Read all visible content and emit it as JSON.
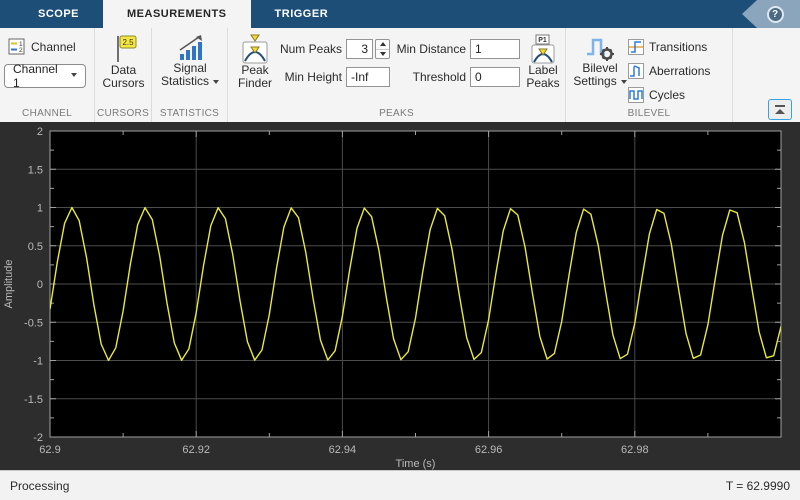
{
  "tabs": {
    "items": [
      {
        "label": "SCOPE",
        "active": false
      },
      {
        "label": "MEASUREMENTS",
        "active": true
      },
      {
        "label": "TRIGGER",
        "active": false
      }
    ],
    "help_label": "?"
  },
  "toolbar": {
    "channel": {
      "label": "Channel",
      "dropdown_value": "Channel 1",
      "group": "CHANNEL"
    },
    "cursors": {
      "line1": "Data",
      "line2": "Cursors",
      "badge": "2.5",
      "group": "CURSORS"
    },
    "statistics": {
      "line1": "Signal",
      "line2": "Statistics",
      "group": "STATISTICS"
    },
    "peaks": {
      "finder_line1": "Peak",
      "finder_line2": "Finder",
      "num_peaks_label": "Num Peaks",
      "num_peaks_value": "3",
      "min_height_label": "Min Height",
      "min_height_value": "-Inf",
      "min_distance_label": "Min Distance",
      "min_distance_value": "1",
      "threshold_label": "Threshold",
      "threshold_value": "0",
      "label_peaks_line1": "Label",
      "label_peaks_line2": "Peaks",
      "label_peaks_badge": "P1",
      "group": "PEAKS"
    },
    "bilevel": {
      "settings_line1": "Bilevel",
      "settings_line2": "Settings",
      "toggles": [
        {
          "label": "Transitions"
        },
        {
          "label": "Aberrations"
        },
        {
          "label": "Cycles"
        }
      ],
      "group": "BILEVEL"
    }
  },
  "chart_data": {
    "type": "line",
    "title": "",
    "xlabel": "Time (s)",
    "ylabel": "Amplitude",
    "xlim": [
      62.9,
      63.0
    ],
    "ylim": [
      -2,
      2
    ],
    "xticks": [
      62.9,
      62.92,
      62.94,
      62.96,
      62.98
    ],
    "xtick_labels": [
      "62.9",
      "62.92",
      "62.94",
      "62.96",
      "62.98"
    ],
    "yticks": [
      -2,
      -1.5,
      -1,
      -0.5,
      0,
      0.5,
      1,
      1.5,
      2
    ],
    "ytick_labels": [
      "-2",
      "-1.5",
      "-1",
      "-0.5",
      "0",
      "0.5",
      "1",
      "1.5",
      "2"
    ],
    "x_minor_step": 0.01,
    "y_minor_step": 0.25,
    "grid": true,
    "legend": "none",
    "background": "#000000",
    "grid_color": "#4c4c4c",
    "axis_color": "#a0a0a0",
    "tick_label_color": "#b9b9b9",
    "line_color": "#e9e93d",
    "series": [
      {
        "name": "Channel 1",
        "signal": {
          "waveform": "sine",
          "frequency_hz": 99.6,
          "amplitude": 1,
          "phase_rad": -0.336,
          "sample_interval_s": 0.001,
          "t_start_s": 62.9,
          "t_end_s": 63.0
        }
      }
    ]
  },
  "status_bar": {
    "left": "Processing",
    "right": "T = 62.9990"
  },
  "colors": {
    "accent_blue": "#1d4e77",
    "waveform_yellow": "#e9e93d",
    "toolbar_bg": "#f4f4f4"
  }
}
